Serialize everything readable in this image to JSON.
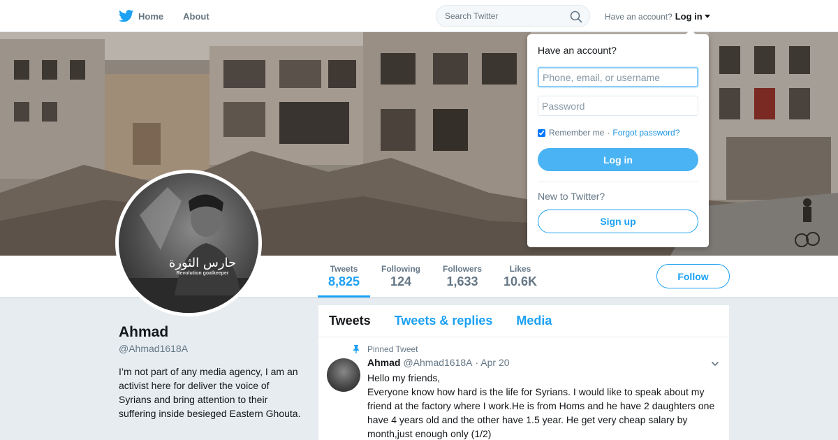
{
  "nav": {
    "home_label": "Home",
    "about_label": "About",
    "search_placeholder": "Search Twitter",
    "account_prompt": "Have an account?",
    "login_label": "Log in"
  },
  "profile": {
    "name": "Ahmad",
    "handle": "@Ahmad1618A",
    "bio": "I’m not part of any media agency, I am an activist here for deliver the voice of Syrians and bring attention to their suffering inside besieged Eastern Ghouta.",
    "avatar_text_ar": "حارس الثورة",
    "avatar_text_en": "Revolution goalkeeper"
  },
  "stats": [
    {
      "label": "Tweets",
      "value": "8,825",
      "active": true
    },
    {
      "label": "Following",
      "value": "124"
    },
    {
      "label": "Followers",
      "value": "1,633"
    },
    {
      "label": "Likes",
      "value": "10.6K"
    }
  ],
  "follow_label": "Follow",
  "timeline": {
    "tabs": [
      "Tweets",
      "Tweets & replies",
      "Media"
    ],
    "active_tab": "Tweets"
  },
  "tweet": {
    "pinned_label": "Pinned Tweet",
    "name": "Ahmad",
    "handle": "@Ahmad1618A",
    "time": "· Apr 20",
    "line1": "Hello my friends,",
    "line2": "Everyone know how hard is the life for Syrians. I would like to speak about my friend at the factory where I work.He is from Homs and he have 2 daughters one have 4 years old and the other have 1.5 year. He get very cheap salary by month,just enough only (1/2)"
  },
  "login_dropdown": {
    "title": "Have an account?",
    "username_placeholder": "Phone, email, or username",
    "password_placeholder": "Password",
    "remember_label": "Remember me",
    "separator": "·",
    "forgot_label": "Forgot password?",
    "login_button": "Log in",
    "new_prompt": "New to Twitter?",
    "signup_button": "Sign up"
  },
  "colors": {
    "accent": "#1da1f2",
    "login_button": "#4ab3f4",
    "background": "#e6ecf0"
  }
}
